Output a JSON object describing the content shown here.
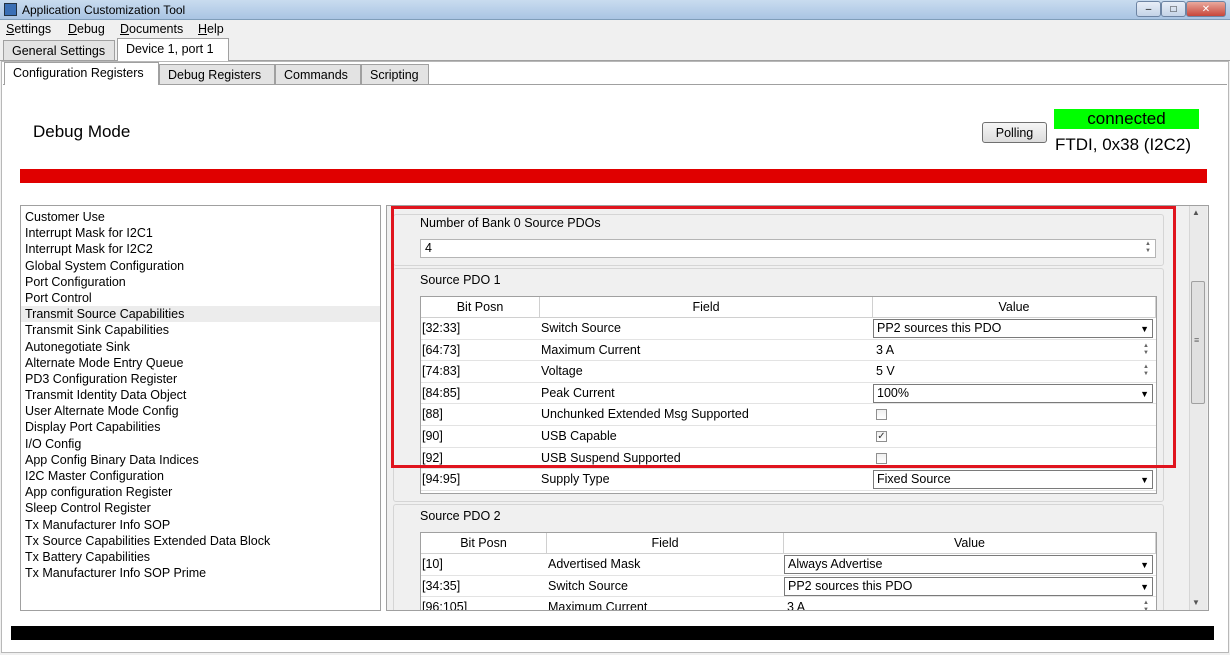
{
  "window": {
    "title": "Application Customization Tool",
    "controls": {
      "minimize": "–",
      "maximize": "□",
      "close": "✕"
    }
  },
  "menu": [
    "Settings",
    "Debug",
    "Documents",
    "Help"
  ],
  "outer_tabs": [
    "General Settings",
    "Device 1, port 1"
  ],
  "inner_tabs": [
    "Configuration Registers",
    "Debug Registers",
    "Commands",
    "Scripting"
  ],
  "header": {
    "mode": "Debug Mode",
    "polling_label": "Polling",
    "status": "connected",
    "device_info": "FTDI, 0x38 (I2C2)",
    "status_color": "#00ff00",
    "alert_color": "#e00000"
  },
  "sidebar": {
    "items": [
      "Customer Use",
      "Interrupt Mask for I2C1",
      "Interrupt Mask for I2C2",
      "Global System Configuration",
      "Port Configuration",
      "Port Control",
      "Transmit Source Capabilities",
      "Transmit Sink Capabilities",
      "Autonegotiate Sink",
      "Alternate Mode Entry Queue",
      "PD3 Configuration Register",
      "Transmit Identity Data Object",
      "User Alternate Mode Config",
      "Display Port Capabilities",
      "I/O Config",
      "App Config Binary Data Indices",
      "I2C Master Configuration",
      "App configuration Register",
      "Sleep Control Register",
      "Tx Manufacturer Info SOP",
      "Tx Source Capabilities Extended Data Block",
      "Tx Battery Capabilities",
      "Tx Manufacturer Info SOP Prime"
    ],
    "selected": "Transmit Source Capabilities"
  },
  "content": {
    "num_pdos_label": "Number of Bank 0 Source PDOs",
    "num_pdos_value": "4",
    "columns": [
      "Bit Posn",
      "Field",
      "Value"
    ],
    "pdo1": {
      "label": "Source PDO 1",
      "rows": [
        {
          "posn": "[32:33]",
          "field": "Switch Source",
          "value": "PP2 sources this PDO"
        },
        {
          "posn": "[64:73]",
          "field": "Maximum Current",
          "value": "3 A"
        },
        {
          "posn": "[74:83]",
          "field": "Voltage",
          "value": "5 V"
        },
        {
          "posn": "[84:85]",
          "field": "Peak Current",
          "value": "100%"
        },
        {
          "posn": "[88]",
          "field": "Unchunked Extended Msg Supported",
          "value": ""
        },
        {
          "posn": "[90]",
          "field": "USB Capable",
          "value": "✓"
        },
        {
          "posn": "[92]",
          "field": "USB Suspend Supported",
          "value": ""
        },
        {
          "posn": "[94:95]",
          "field": "Supply Type",
          "value": "Fixed Source"
        }
      ]
    },
    "pdo2": {
      "label": "Source PDO 2",
      "rows": [
        {
          "posn": "[10]",
          "field": "Advertised Mask",
          "value": "Always Advertise"
        },
        {
          "posn": "[34:35]",
          "field": "Switch Source",
          "value": "PP2 sources this PDO"
        },
        {
          "posn": "[96:105]",
          "field": "Maximum Current",
          "value": "3 A"
        }
      ]
    }
  }
}
